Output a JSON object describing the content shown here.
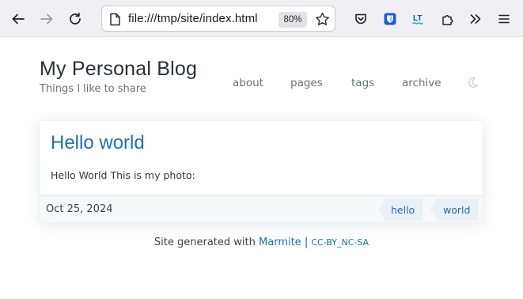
{
  "browser": {
    "url": "file:///tmp/site/index.html",
    "zoom": "80%",
    "icons": [
      "back-arrow-icon",
      "forward-arrow-icon",
      "reload-icon",
      "page-icon",
      "star-icon",
      "pocket-icon",
      "bitwarden-icon",
      "languagetool-icon",
      "extensions-icon",
      "overflow-chevrons-icon",
      "menu-icon"
    ],
    "ext_bitwarden_color": "#175ddc",
    "ext_languagetool_color": "#0c5d96"
  },
  "site": {
    "title": "My Personal Blog",
    "tagline": "Things I like to share",
    "nav": [
      {
        "label": "about"
      },
      {
        "label": "pages"
      },
      {
        "label": "tags"
      },
      {
        "label": "archive"
      }
    ],
    "theme_toggle_icon": "moon-icon",
    "accent_color": "#1a73b0"
  },
  "post": {
    "title": "Hello world",
    "body": "Hello World This is my photo:",
    "date": "Oct 25, 2024",
    "tags": [
      "hello",
      "world"
    ]
  },
  "footer": {
    "prefix": "Site generated with",
    "generator": "Marmite",
    "separator": "|",
    "license": "CC-BY_NC-SA"
  }
}
